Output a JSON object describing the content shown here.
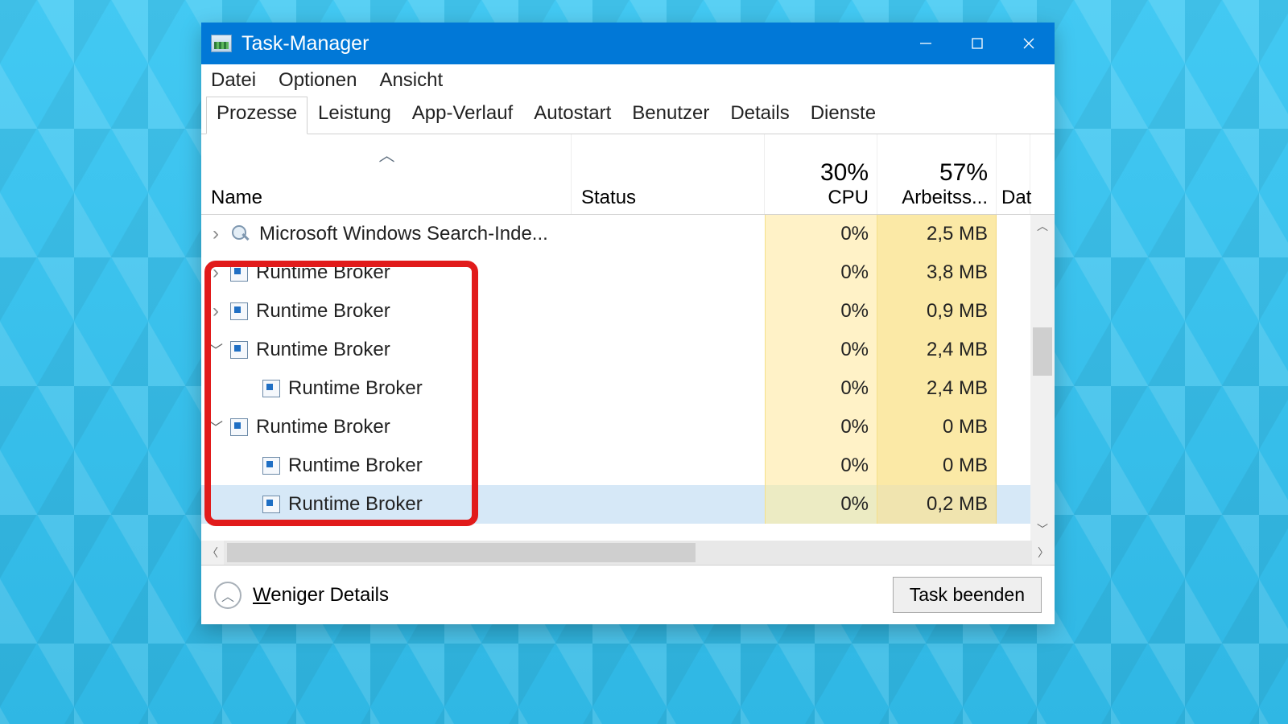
{
  "window": {
    "title": "Task-Manager"
  },
  "menu": {
    "file": "Datei",
    "options": "Optionen",
    "view": "Ansicht"
  },
  "tabs": {
    "processes": "Prozesse",
    "performance": "Leistung",
    "app_history": "App-Verlauf",
    "startup": "Autostart",
    "users": "Benutzer",
    "details": "Details",
    "services": "Dienste"
  },
  "columns": {
    "name": "Name",
    "status": "Status",
    "cpu_pct": "30%",
    "cpu_label": "CPU",
    "mem_pct": "57%",
    "mem_label": "Arbeitss...",
    "data_label": "Dat"
  },
  "rows": [
    {
      "name": "Microsoft Windows Search-Inde...",
      "cpu": "0%",
      "mem": "2,5 MB",
      "icon": "search",
      "chevron": "right",
      "child": false,
      "selected": false
    },
    {
      "name": "Runtime Broker",
      "cpu": "0%",
      "mem": "3,8 MB",
      "icon": "proc",
      "chevron": "right",
      "child": false,
      "selected": false
    },
    {
      "name": "Runtime Broker",
      "cpu": "0%",
      "mem": "0,9 MB",
      "icon": "proc",
      "chevron": "right",
      "child": false,
      "selected": false
    },
    {
      "name": "Runtime Broker",
      "cpu": "0%",
      "mem": "2,4 MB",
      "icon": "proc",
      "chevron": "down",
      "child": false,
      "selected": false
    },
    {
      "name": "Runtime Broker",
      "cpu": "0%",
      "mem": "2,4 MB",
      "icon": "proc",
      "chevron": "none",
      "child": true,
      "selected": false
    },
    {
      "name": "Runtime Broker",
      "cpu": "0%",
      "mem": "0 MB",
      "icon": "proc",
      "chevron": "down",
      "child": false,
      "selected": false
    },
    {
      "name": "Runtime Broker",
      "cpu": "0%",
      "mem": "0 MB",
      "icon": "proc",
      "chevron": "none",
      "child": true,
      "selected": false
    },
    {
      "name": "Runtime Broker",
      "cpu": "0%",
      "mem": "0,2 MB",
      "icon": "proc",
      "chevron": "none",
      "child": true,
      "selected": true
    }
  ],
  "footer": {
    "fewer_details": "Weniger Details",
    "end_task": "Task beenden"
  },
  "highlight": {
    "purpose": "Runtime Broker rows highlighted"
  }
}
